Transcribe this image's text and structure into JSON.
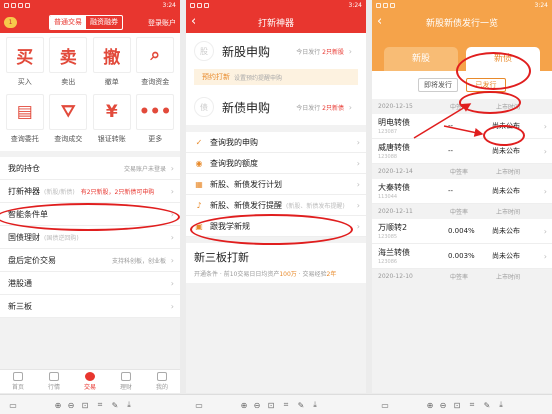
{
  "status_time": "3:24",
  "panel1": {
    "bell_count": "1",
    "seg_left": "普通交易",
    "seg_right": "融资融券",
    "login": "登录账户",
    "grid": [
      {
        "glyph": "买",
        "label": "买入"
      },
      {
        "glyph": "卖",
        "label": "卖出"
      },
      {
        "glyph": "撤",
        "label": "撤单"
      },
      {
        "glyph": "⌕",
        "label": "查询资金"
      },
      {
        "glyph": "▤",
        "label": "查询委托"
      },
      {
        "glyph": "⛛",
        "label": "查询成交"
      },
      {
        "glyph": "¥",
        "label": "银证转账"
      },
      {
        "glyph": "•••",
        "label": "更多"
      }
    ],
    "rows": [
      {
        "title": "我的持仓",
        "sub": "",
        "hl": "",
        "right": "交易账户未登录"
      },
      {
        "title": "打新神器",
        "sub": "(新股/新债)",
        "hl": "有2只新股，2只新债可申购",
        "right": ""
      },
      {
        "title": "智能条件单",
        "sub": "",
        "hl": "",
        "right": ""
      },
      {
        "title": "国债理财",
        "sub": "(国债逆回购)",
        "hl": "",
        "right": ""
      },
      {
        "title": "盘后定价交易",
        "sub": "",
        "hl": "",
        "right": "支持科创板，创业板"
      },
      {
        "title": "港股通",
        "sub": "",
        "hl": "",
        "right": ""
      },
      {
        "title": "新三板",
        "sub": "",
        "hl": "",
        "right": ""
      }
    ],
    "tabs": [
      "首页",
      "行情",
      "交易",
      "理财",
      "我的"
    ]
  },
  "panel2": {
    "title": "打新神器",
    "stock": {
      "circle": "股",
      "title": "新股申购",
      "right_prefix": "今日发行",
      "right_count": "2只新股"
    },
    "notice": {
      "label": "预约打新",
      "text": "设置预约提醒申购"
    },
    "bond": {
      "circle": "债",
      "title": "新债申购",
      "right_prefix": "今日发行",
      "right_count": "2只新债"
    },
    "items": [
      {
        "icon": "✓",
        "label": "查询我的申购",
        "sub": ""
      },
      {
        "icon": "◉",
        "label": "查询我的额度",
        "sub": ""
      },
      {
        "icon": "▦",
        "label": "新股、新债发行计划",
        "sub": ""
      },
      {
        "icon": "♪",
        "label": "新股、新债发行提醒",
        "sub": "(新股、新债发布提醒)"
      },
      {
        "icon": "▣",
        "label": "跟我学新规",
        "sub": ""
      }
    ],
    "sanban": {
      "title": "新三板打新",
      "line_a": "开通条件 · 前10交易日日均资产",
      "amount": "100万",
      "line_b": " · 交易经验",
      "years": "2年"
    }
  },
  "panel3": {
    "title": "新股新债发行一览",
    "tab_stock": "新股",
    "tab_bond": "新债",
    "sub_pending": "即将发行",
    "sub_issued": "已发行",
    "groups": [
      {
        "date": "2020-12-15",
        "col2": "中签率",
        "col3": "上市时间",
        "bonds": [
          {
            "name": "明电转债",
            "code": "123087",
            "rate": "--",
            "status": "尚未公布"
          },
          {
            "name": "威唐转债",
            "code": "123088",
            "rate": "--",
            "status": "尚未公布"
          }
        ]
      },
      {
        "date": "2020-12-14",
        "col2": "中签率",
        "col3": "上市时间",
        "bonds": [
          {
            "name": "大秦转债",
            "code": "113044",
            "rate": "--",
            "status": "尚未公布"
          }
        ]
      },
      {
        "date": "2020-12-11",
        "col2": "中签率",
        "col3": "上市时间",
        "bonds": [
          {
            "name": "万顺转2",
            "code": "123085",
            "rate": "0.004%",
            "status": "尚未公布"
          },
          {
            "name": "海兰转债",
            "code": "123086",
            "rate": "0.003%",
            "status": "尚未公布"
          }
        ]
      },
      {
        "date": "2020-12-10",
        "col2": "中签率",
        "col3": "上市时间",
        "bonds": []
      }
    ]
  },
  "colors": {
    "red": "#e8362f",
    "orange": "#f5a34a",
    "annotation": "#e01e1e"
  }
}
